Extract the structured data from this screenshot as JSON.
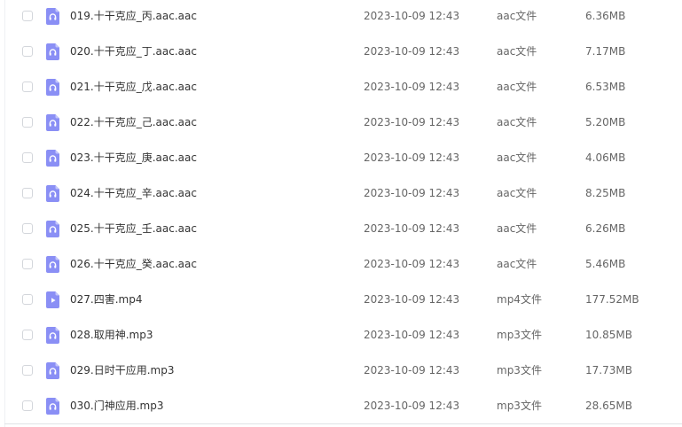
{
  "files": [
    {
      "name": "019.十干克应_丙.aac.aac",
      "date": "2023-10-09 12:43",
      "type": "aac文件",
      "size": "6.36MB",
      "icon": "audio-file-icon"
    },
    {
      "name": "020.十干克应_丁.aac.aac",
      "date": "2023-10-09 12:43",
      "type": "aac文件",
      "size": "7.17MB",
      "icon": "audio-file-icon"
    },
    {
      "name": "021.十干克应_戊.aac.aac",
      "date": "2023-10-09 12:43",
      "type": "aac文件",
      "size": "6.53MB",
      "icon": "audio-file-icon"
    },
    {
      "name": "022.十干克应_己.aac.aac",
      "date": "2023-10-09 12:43",
      "type": "aac文件",
      "size": "5.20MB",
      "icon": "audio-file-icon"
    },
    {
      "name": "023.十干克应_庚.aac.aac",
      "date": "2023-10-09 12:43",
      "type": "aac文件",
      "size": "4.06MB",
      "icon": "audio-file-icon"
    },
    {
      "name": "024.十干克应_辛.aac.aac",
      "date": "2023-10-09 12:43",
      "type": "aac文件",
      "size": "8.25MB",
      "icon": "audio-file-icon"
    },
    {
      "name": "025.十干克应_壬.aac.aac",
      "date": "2023-10-09 12:43",
      "type": "aac文件",
      "size": "6.26MB",
      "icon": "audio-file-icon"
    },
    {
      "name": "026.十干克应_癸.aac.aac",
      "date": "2023-10-09 12:43",
      "type": "aac文件",
      "size": "5.46MB",
      "icon": "audio-file-icon"
    },
    {
      "name": "027.四害.mp4",
      "date": "2023-10-09 12:43",
      "type": "mp4文件",
      "size": "177.52MB",
      "icon": "video-file-icon"
    },
    {
      "name": "028.取用神.mp3",
      "date": "2023-10-09 12:43",
      "type": "mp3文件",
      "size": "10.85MB",
      "icon": "audio-file-icon"
    },
    {
      "name": "029.日时干应用.mp3",
      "date": "2023-10-09 12:43",
      "type": "mp3文件",
      "size": "17.73MB",
      "icon": "audio-file-icon"
    },
    {
      "name": "030.门神应用.mp3",
      "date": "2023-10-09 12:43",
      "type": "mp3文件",
      "size": "28.65MB",
      "icon": "audio-file-icon"
    }
  ],
  "colors": {
    "icon_fill": "#8a8ff5",
    "icon_fold": "#c3c6fb",
    "icon_glyph": "#ffffff"
  }
}
